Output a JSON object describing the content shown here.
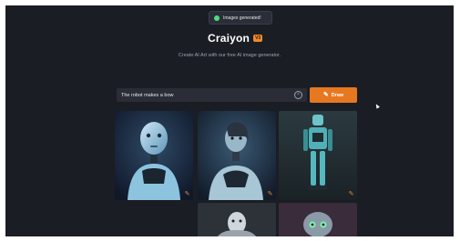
{
  "toast": {
    "text": "Images generated!",
    "icon": "check-circle-icon"
  },
  "brand": {
    "name": "Craiyon",
    "badge": "V3",
    "accent": "#f08a26"
  },
  "tagline": "Create AI Art with our free AI image generator.",
  "prompt": {
    "value": "The robot makes a bow"
  },
  "draw_button": {
    "label": "Draw",
    "icon": "pencil-icon"
  },
  "results": {
    "images": [
      {
        "subject": "blue humanoid robot bust",
        "icon": "edit-pencil-icon"
      },
      {
        "subject": "female android robot",
        "icon": "edit-pencil-icon"
      },
      {
        "subject": "full-body teal robot",
        "icon": "edit-pencil-icon"
      },
      {
        "subject": "robot head partial",
        "icon": "edit-pencil-icon"
      },
      {
        "subject": "robot with green eyes partial",
        "icon": "edit-pencil-icon"
      }
    ]
  }
}
